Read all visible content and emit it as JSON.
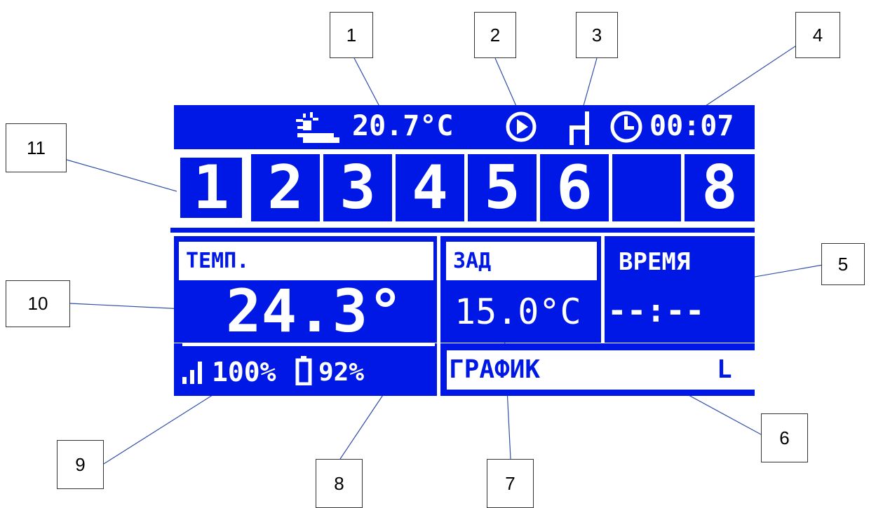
{
  "header": {
    "outdoor_temp": "20.7°C",
    "clock": "00:07"
  },
  "zones": [
    "1",
    "2",
    "3",
    "4",
    "5",
    "6",
    "",
    "8"
  ],
  "main": {
    "temp_label": "ТЕМП.",
    "temp_value": "24.3°",
    "setpoint_label": "ЗАД",
    "setpoint_value": "15.0°C",
    "time_label": "ВРЕМЯ",
    "time_value": "--:--"
  },
  "footer": {
    "signal": "100%",
    "battery": "92%",
    "schedule_label": "ГРАФИК",
    "schedule_code": "L"
  },
  "callouts": [
    "1",
    "2",
    "3",
    "4",
    "5",
    "6",
    "7",
    "8",
    "9",
    "10",
    "11"
  ],
  "colors": {
    "lcd_blue": "#0018e6",
    "lcd_fg": "#ffffff",
    "leader": "#2f4fa8"
  },
  "icons": [
    "weather-sun-cloud-icon",
    "mode-play-icon",
    "chair-icon",
    "clock-icon",
    "signal-bars-icon",
    "battery-icon"
  ]
}
